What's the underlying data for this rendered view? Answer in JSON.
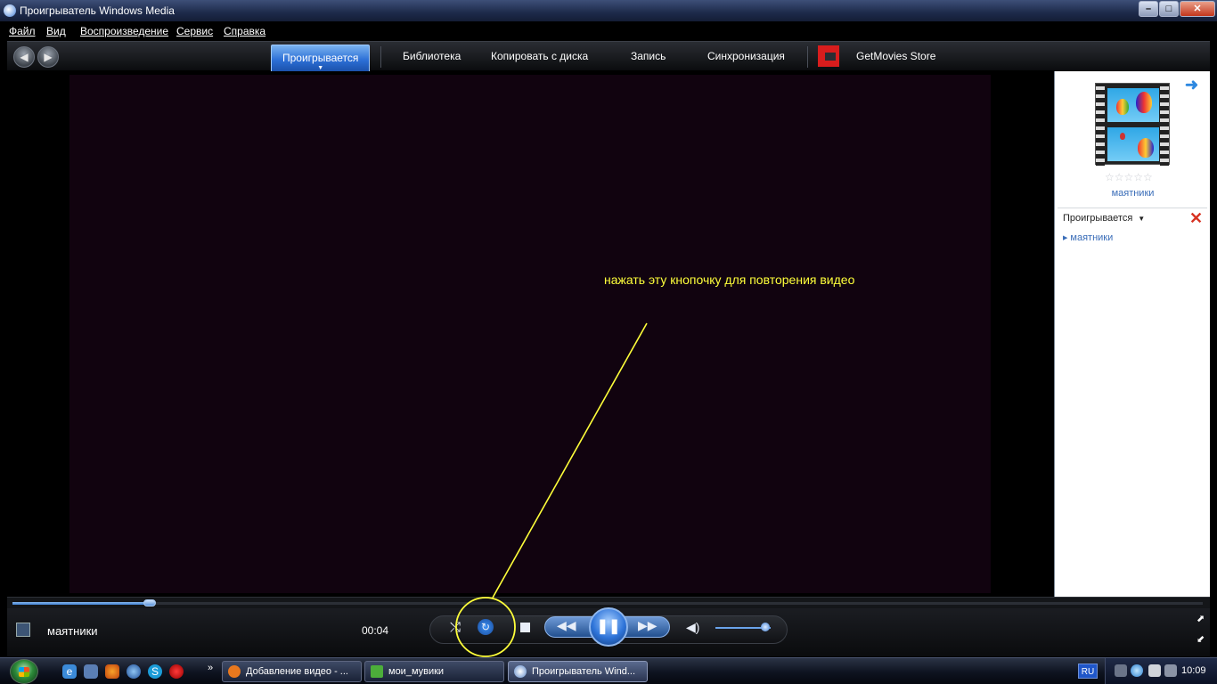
{
  "window": {
    "title": "Проигрыватель Windows Media",
    "buttons": {
      "minimize": "–",
      "maximize": "□",
      "close": "✕"
    }
  },
  "menu": [
    "Файл",
    "Вид",
    "Воспроизведение",
    "Сервис",
    "Справка"
  ],
  "nav": {
    "back": "◀",
    "forward": "▶",
    "tabs": [
      "Проигрывается",
      "Библиотека",
      "Копировать с диска",
      "Запись",
      "Синхронизация"
    ],
    "active_tab": "Проигрывается",
    "store": "GetMovies Store"
  },
  "video": {
    "annotation": "нажать эту кнопочку для повторения видео"
  },
  "panel": {
    "album_title": "маятники",
    "rating_stars": "☆☆☆☆☆",
    "rating": 0,
    "playlist_header": "Проигрывается",
    "playlist": [
      "маятники"
    ],
    "colors": {
      "link": "#3a6db8",
      "clear": "#d73221"
    }
  },
  "player": {
    "now_playing": "маятники",
    "time": "00:04",
    "seek_fraction": 0.115,
    "volume_fraction": 0.9,
    "icons": {
      "shuffle": "shuffle-icon",
      "repeat": "repeat-icon",
      "stop": "stop-icon",
      "previous": "rewind-icon",
      "play_pause": "pause-icon",
      "next": "fast-forward-icon",
      "mute": "speaker-icon"
    },
    "glyphs": {
      "shuffle": "⤭",
      "repeat": "↻",
      "prev": "◀◀",
      "play": "❚❚",
      "next": "▶▶",
      "mute": "🔊"
    }
  },
  "taskbar": {
    "quick_more": "»",
    "tasks": [
      {
        "label": "Добавление видео - ...",
        "color": "#e8781e"
      },
      {
        "label": "мои_мувики",
        "color": "#4cae3a"
      },
      {
        "label": "Проигрыватель Wind...",
        "color": "#ffffff"
      }
    ],
    "language": "RU",
    "clock": "10:09"
  }
}
